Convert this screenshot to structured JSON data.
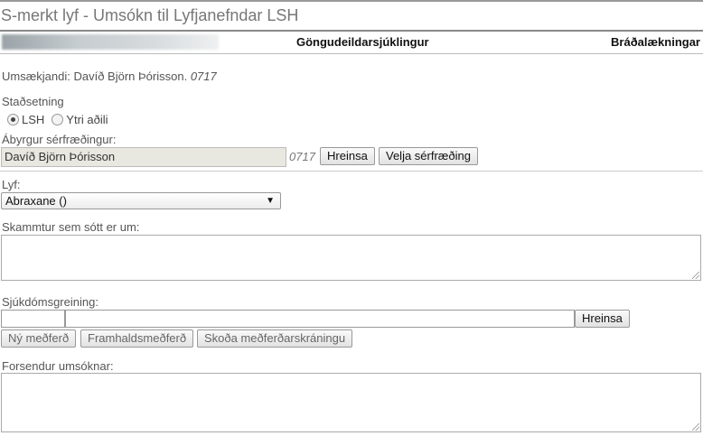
{
  "page": {
    "title": "S-merkt lyf - Umsókn til Lyfjanefndar LSH"
  },
  "subheader": {
    "department": "Göngudeildarsjúklingur",
    "specialty": "Bráðalækningar"
  },
  "applicant": {
    "label": "Umsækjandi: Davíð Björn Þórisson.",
    "code": "0717"
  },
  "location": {
    "label": "Staðsetning",
    "options": [
      "LSH",
      "Ytri aðili"
    ],
    "selected": "LSH"
  },
  "specialist": {
    "label": "Ábyrgur sérfræðingur:",
    "value": "Davíð Björn Þórisson",
    "code": "0717",
    "clear_button": "Hreinsa",
    "choose_button": "Velja sérfræðing"
  },
  "drug": {
    "label": "Lyf:",
    "selected": "Abraxane ()"
  },
  "dose": {
    "label": "Skammtur sem sótt er um:"
  },
  "diagnosis": {
    "label": "Sjúkdómsgreining:",
    "clear_button": "Hreinsa",
    "new_treatment_button": "Ný meðferð",
    "continued_treatment_button": "Framhaldsmeðferð",
    "view_registration_button": "Skoða meðferðarskráningu"
  },
  "reasons": {
    "label": "Forsendur umsóknar:"
  },
  "icons": {
    "select_arrow": "chevron-down-icon",
    "resize": "resize-grip-icon"
  }
}
